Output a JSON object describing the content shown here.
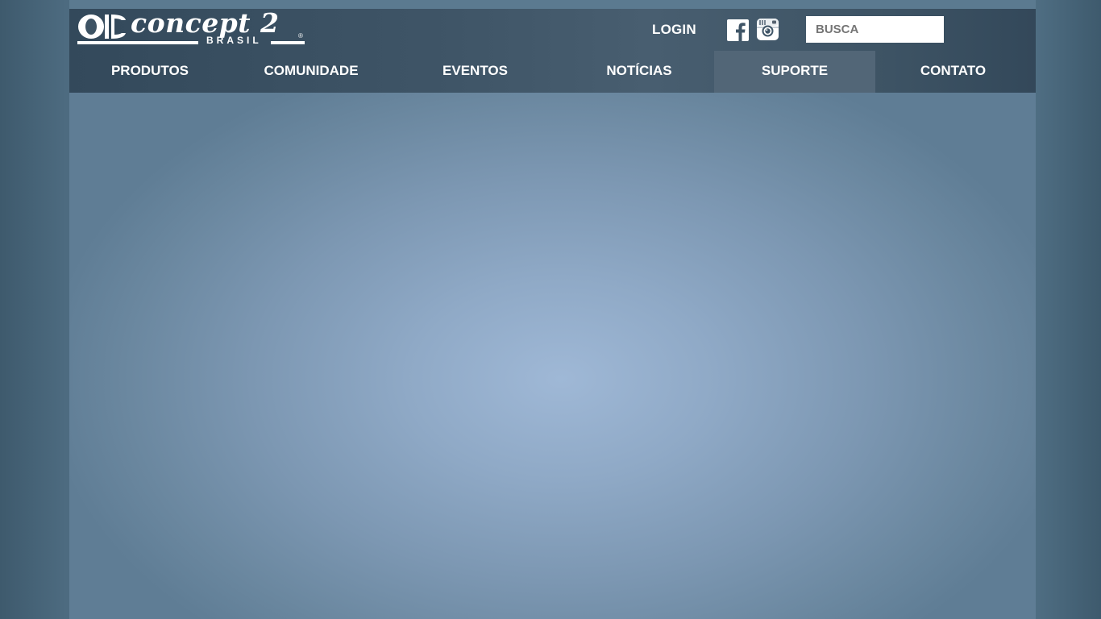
{
  "header": {
    "logo": {
      "name": "concept 2",
      "sub": "BRASIL",
      "registered": "®"
    },
    "login_label": "LOGIN",
    "social": {
      "facebook_icon": "facebook-icon",
      "instagram_icon": "instagram-icon"
    },
    "search": {
      "placeholder": "BUSCA"
    }
  },
  "nav": {
    "items": [
      {
        "label": "PRODUTOS",
        "active": false
      },
      {
        "label": "COMUNIDADE",
        "active": false
      },
      {
        "label": "EVENTOS",
        "active": false
      },
      {
        "label": "NOTÍCIAS",
        "active": false
      },
      {
        "label": "SUPORTE",
        "active": true
      },
      {
        "label": "CONTATO",
        "active": false
      }
    ]
  },
  "colors": {
    "header_bg": "#3f5567",
    "active_nav_bg": "#526677",
    "content_center": "#9fb8d6",
    "outer_bg": "#4d6b80"
  }
}
